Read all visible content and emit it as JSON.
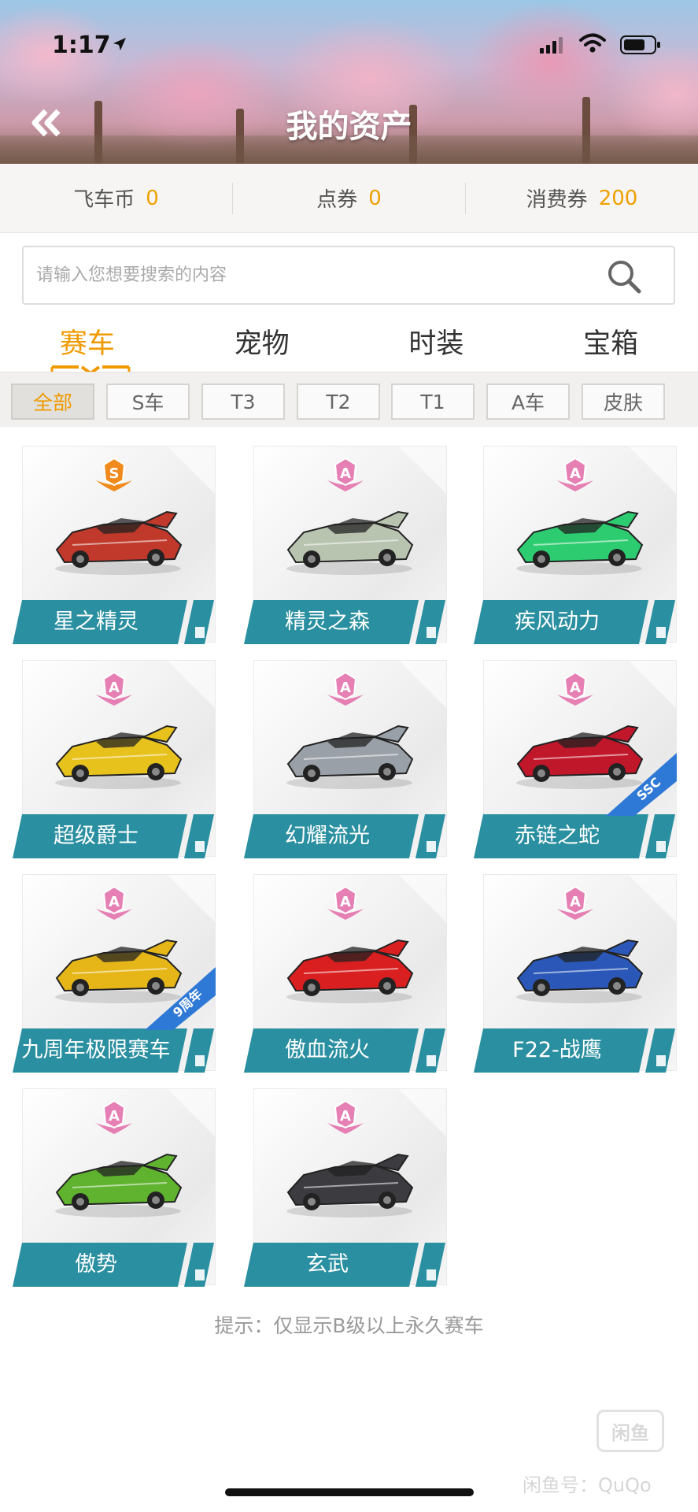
{
  "status_bar": {
    "time": "1:17"
  },
  "header": {
    "title": "我的资产"
  },
  "currencies": [
    {
      "label": "飞车币",
      "value": "0"
    },
    {
      "label": "点券",
      "value": "0"
    },
    {
      "label": "消费券",
      "value": "200"
    }
  ],
  "search": {
    "placeholder": "请输入您想要搜索的内容"
  },
  "tabs": [
    {
      "label": "赛车",
      "active": true
    },
    {
      "label": "宠物",
      "active": false
    },
    {
      "label": "时装",
      "active": false
    },
    {
      "label": "宝箱",
      "active": false
    }
  ],
  "filters": [
    {
      "label": "全部",
      "active": true
    },
    {
      "label": "S车",
      "active": false
    },
    {
      "label": "T3",
      "active": false
    },
    {
      "label": "T2",
      "active": false
    },
    {
      "label": "T1",
      "active": false
    },
    {
      "label": "A车",
      "active": false
    },
    {
      "label": "皮肤",
      "active": false
    }
  ],
  "cars": [
    {
      "name": "星之精灵",
      "grade": "S",
      "color": "#c0392b"
    },
    {
      "name": "精灵之森",
      "grade": "A",
      "color": "#b9c4b0"
    },
    {
      "name": "疾风动力",
      "grade": "A",
      "color": "#2ecc71"
    },
    {
      "name": "超级爵士",
      "grade": "A",
      "color": "#e7c21c"
    },
    {
      "name": "幻耀流光",
      "grade": "A",
      "color": "#9aa0a8"
    },
    {
      "name": "赤链之蛇",
      "grade": "A",
      "color": "#c0172b",
      "badge": "SSC"
    },
    {
      "name": "九周年极限赛车",
      "grade": "A",
      "color": "#e6b619",
      "badge": "9周年"
    },
    {
      "name": "傲血流火",
      "grade": "A",
      "color": "#d91f1f"
    },
    {
      "name": "F22-战鹰",
      "grade": "A",
      "color": "#2b58b8"
    },
    {
      "name": "傲势",
      "grade": "A",
      "color": "#5fb32e"
    },
    {
      "name": "玄武",
      "grade": "A",
      "color": "#3b3b40"
    }
  ],
  "hint": "提示：仅显示B级以上永久赛车",
  "watermark": {
    "logo": "闲鱼",
    "text": "闲鱼号：QuQo"
  },
  "colors": {
    "accent": "#f09a00",
    "band": "#2a8fa0",
    "band_dark": "#1f6f7e",
    "grade_pink": "#e57fb4",
    "grade_s": "#f08a1c"
  }
}
